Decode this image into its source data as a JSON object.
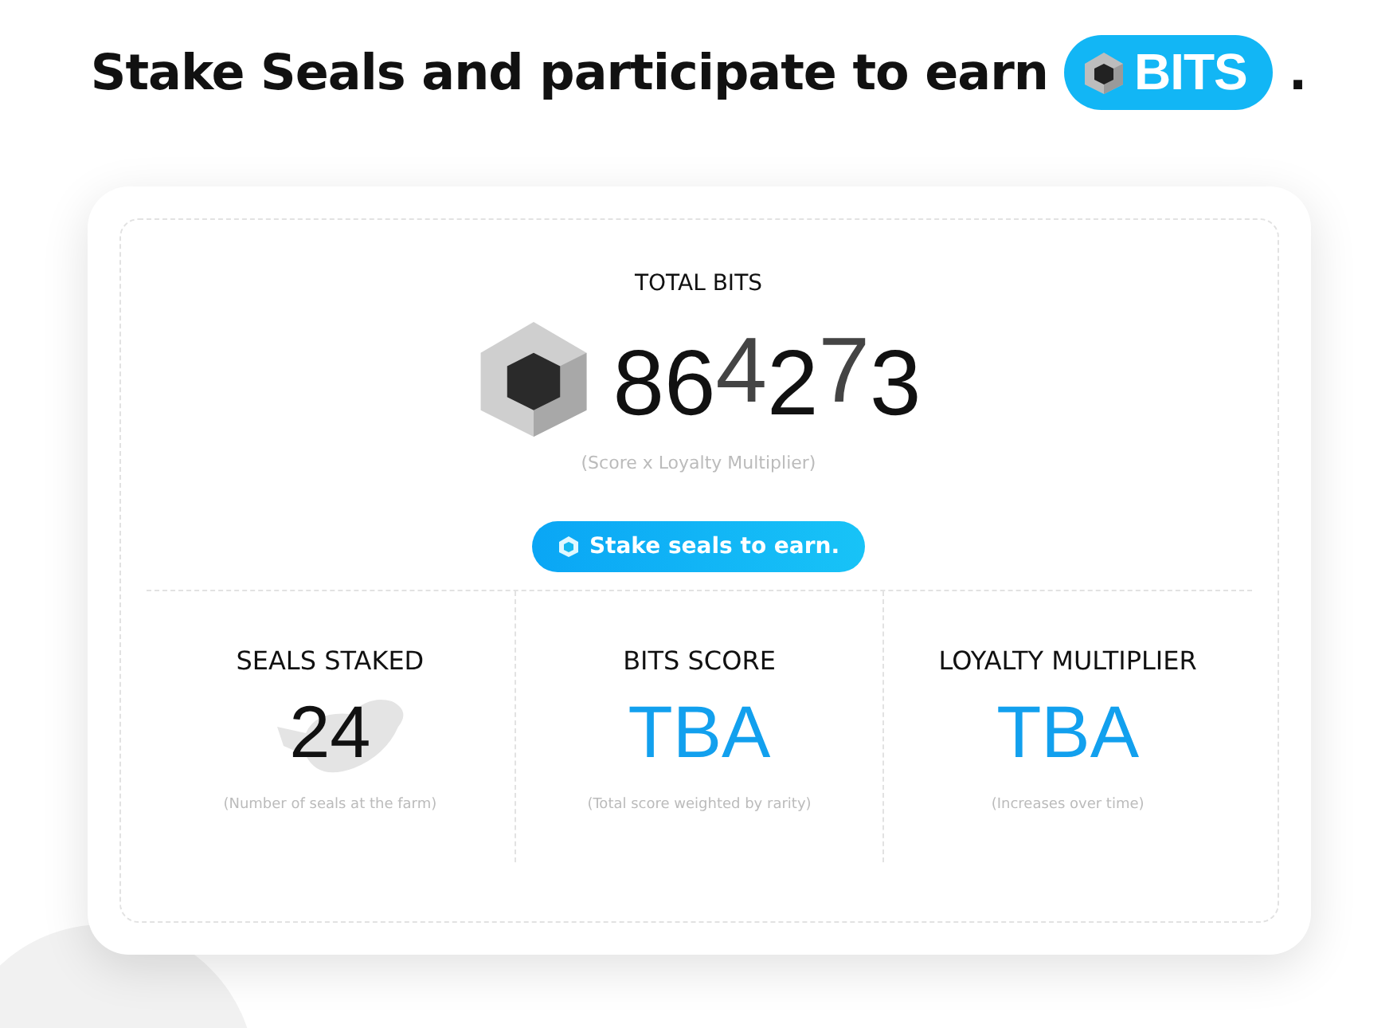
{
  "headline": {
    "text": "Stake Seals and participate to earn",
    "badge": "BITS",
    "end": "."
  },
  "total": {
    "label": "TOTAL BITS",
    "digits": [
      {
        "char": "8",
        "rolling": false
      },
      {
        "char": "6",
        "rolling": false
      },
      {
        "char": "4",
        "rolling": true
      },
      {
        "char": "2",
        "rolling": false
      },
      {
        "char": "7",
        "rolling": true
      },
      {
        "char": "3",
        "rolling": false
      }
    ],
    "note": "(Score x Loyalty Multiplier)"
  },
  "cta": {
    "label": "Stake seals to earn."
  },
  "stats": [
    {
      "label": "SEALS STAKED",
      "value": "24",
      "kind": "count",
      "note": "(Number of seals at the farm)"
    },
    {
      "label": "BITS SCORE",
      "value": "TBA",
      "kind": "pending",
      "note": "(Total score weighted by rarity)"
    },
    {
      "label": "LOYALTY MULTIPLIER",
      "value": "TBA",
      "kind": "pending",
      "note": "(Increases over time)"
    }
  ]
}
